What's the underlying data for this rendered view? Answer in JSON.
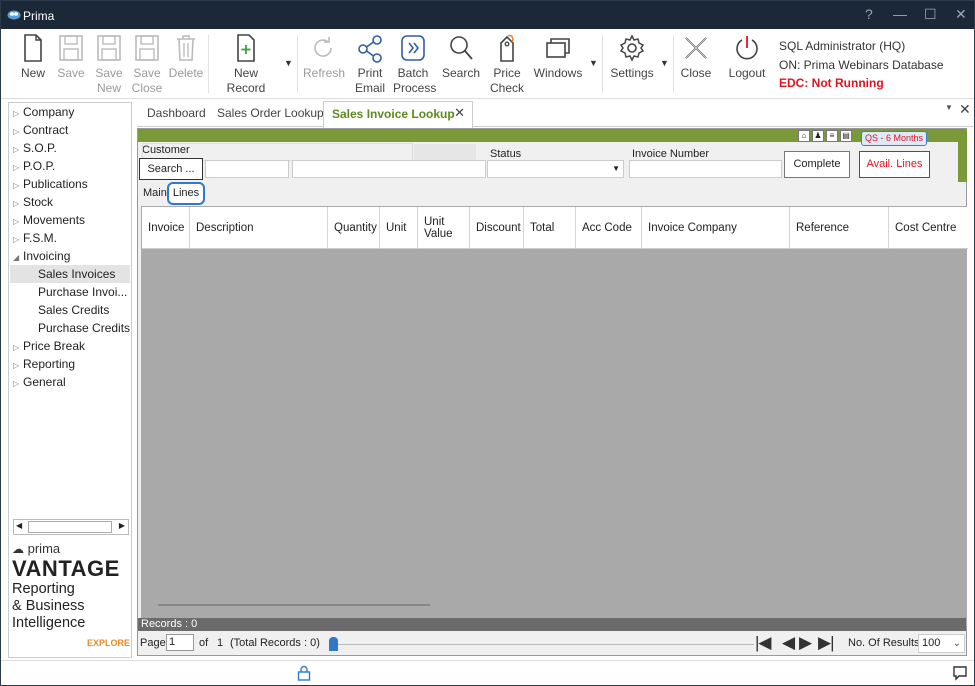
{
  "window": {
    "title": "Prima"
  },
  "ribbon": {
    "new": "New",
    "save": "Save",
    "save_new_1": "Save",
    "save_new_2": "New",
    "save_close_1": "Save",
    "save_close_2": "Close",
    "delete": "Delete",
    "new_record": "New Record",
    "refresh": "Refresh",
    "print_email_1": "Print",
    "print_email_2": "Email",
    "batch_1": "Batch",
    "batch_2": "Process",
    "search": "Search",
    "price_1": "Price",
    "price_2": "Check",
    "windows": "Windows",
    "settings": "Settings",
    "close": "Close",
    "logout": "Logout"
  },
  "user": {
    "line1": "SQL Administrator (HQ)",
    "line2": "ON: Prima Webinars Database",
    "edc": "EDC: Not Running"
  },
  "sidebar": {
    "items": [
      "Company",
      "Contract",
      "S.O.P.",
      "P.O.P.",
      "Publications",
      "Stock",
      "Movements",
      "F.S.M.",
      "Invoicing"
    ],
    "invoicing_children": [
      "Sales Invoices",
      "Purchase Invoi...",
      "Sales Credits",
      "Purchase Credits"
    ],
    "items_after": [
      "Price Break",
      "Reporting",
      "General"
    ]
  },
  "brand": {
    "prima": "prima",
    "vantage": "VANTAGE",
    "l1": "Reporting",
    "l2": "& Business",
    "l3": "Intelligence",
    "explore": "EXPLORE"
  },
  "tabs": {
    "t1": "Dashboard",
    "t2": "Sales Order Lookup",
    "t3": "Sales Invoice Lookup"
  },
  "form": {
    "customer": "Customer",
    "search_btn": "Search ...",
    "status": "Status",
    "invoice_number": "Invoice Number",
    "complete": "Complete",
    "avail_lines": "Avail. Lines",
    "qs": "QS - 6 Months",
    "subtab_main": "Main",
    "subtab_lines": "Lines"
  },
  "grid": {
    "columns": [
      "Invoice",
      "Description",
      "Quantity",
      "Unit",
      "Unit Value",
      "Discount",
      "Total",
      "Acc Code",
      "Invoice Company",
      "Reference",
      "Cost Centre"
    ]
  },
  "records": "Records : 0",
  "pager": {
    "page": "Page",
    "page_value": "1",
    "of": "of",
    "of_value": "1",
    "total": "(Total Records : 0)",
    "results_label": "No. Of Results",
    "results_value": "100"
  },
  "colors": {
    "accent_green": "#7a9a3a",
    "tab_green": "#5c8a1d",
    "edc_red": "#e0141e",
    "highlight_blue": "#2f79c9",
    "explore_orange": "#e88a2a"
  }
}
